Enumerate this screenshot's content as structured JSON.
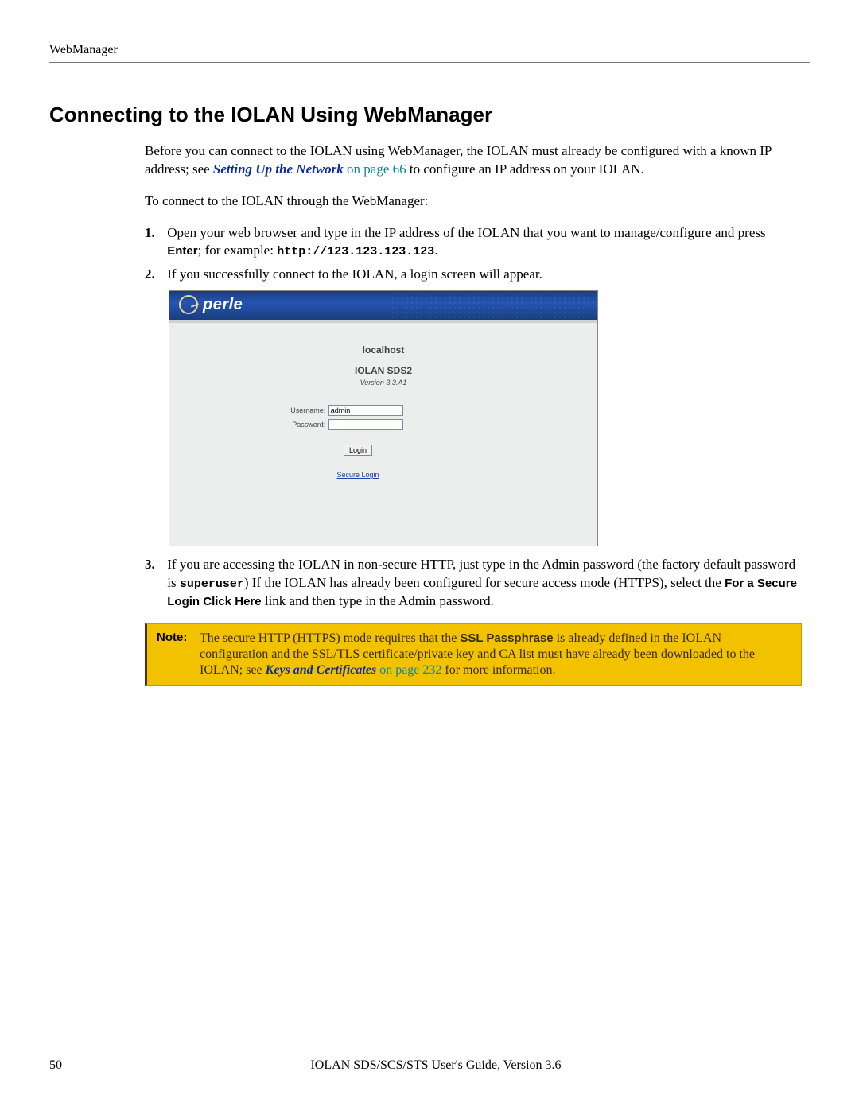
{
  "header": {
    "running": "WebManager"
  },
  "title": "Connecting to the IOLAN Using WebManager",
  "intro": {
    "p1a": "Before you can connect to the IOLAN using WebManager, the IOLAN must already be configured with a known IP address; see ",
    "link1": "Setting Up the Network",
    "link1_tail": " on page 66",
    "p1b": " to configure an IP address on your IOLAN.",
    "p2": "To connect to the IOLAN through the WebManager:"
  },
  "steps": {
    "s1a": "Open your web browser and type in the IP address of the IOLAN that you want to manage/configure and press ",
    "s1_enter": "Enter",
    "s1b": "; for example: ",
    "s1_url": "http://123.123.123.123",
    "s1c": ".",
    "s2": "If you successfully connect to the IOLAN, a login screen will appear.",
    "s3a": "If you are accessing the IOLAN in non-secure HTTP, just type in the Admin password (the factory default password is ",
    "s3_pw": "superuser",
    "s3b": ") If the IOLAN has already been configured for secure access mode (HTTPS), select the ",
    "s3_link_label": "For a Secure Login Click Here",
    "s3c": " link and then type in the Admin password."
  },
  "login": {
    "brand": "perle",
    "host": "localhost",
    "model": "IOLAN SDS2",
    "version": "Version 3.3.A1",
    "user_label": "Username:",
    "user_value": "admin",
    "pass_label": "Password:",
    "pass_value": "",
    "login_btn": "Login",
    "secure": "Secure Login"
  },
  "note": {
    "label": "Note:",
    "a": "The secure HTTP (HTTPS) mode requires that the ",
    "ssl": "SSL Passphrase",
    "b": " is already defined in the IOLAN configuration and the SSL/TLS certificate/private key and CA list must have already been downloaded to the IOLAN; see ",
    "link": "Keys and Certificates",
    "link_tail": " on page 232",
    "c": " for more information."
  },
  "footer": {
    "page": "50",
    "text": "IOLAN SDS/SCS/STS User's Guide, Version 3.6"
  }
}
